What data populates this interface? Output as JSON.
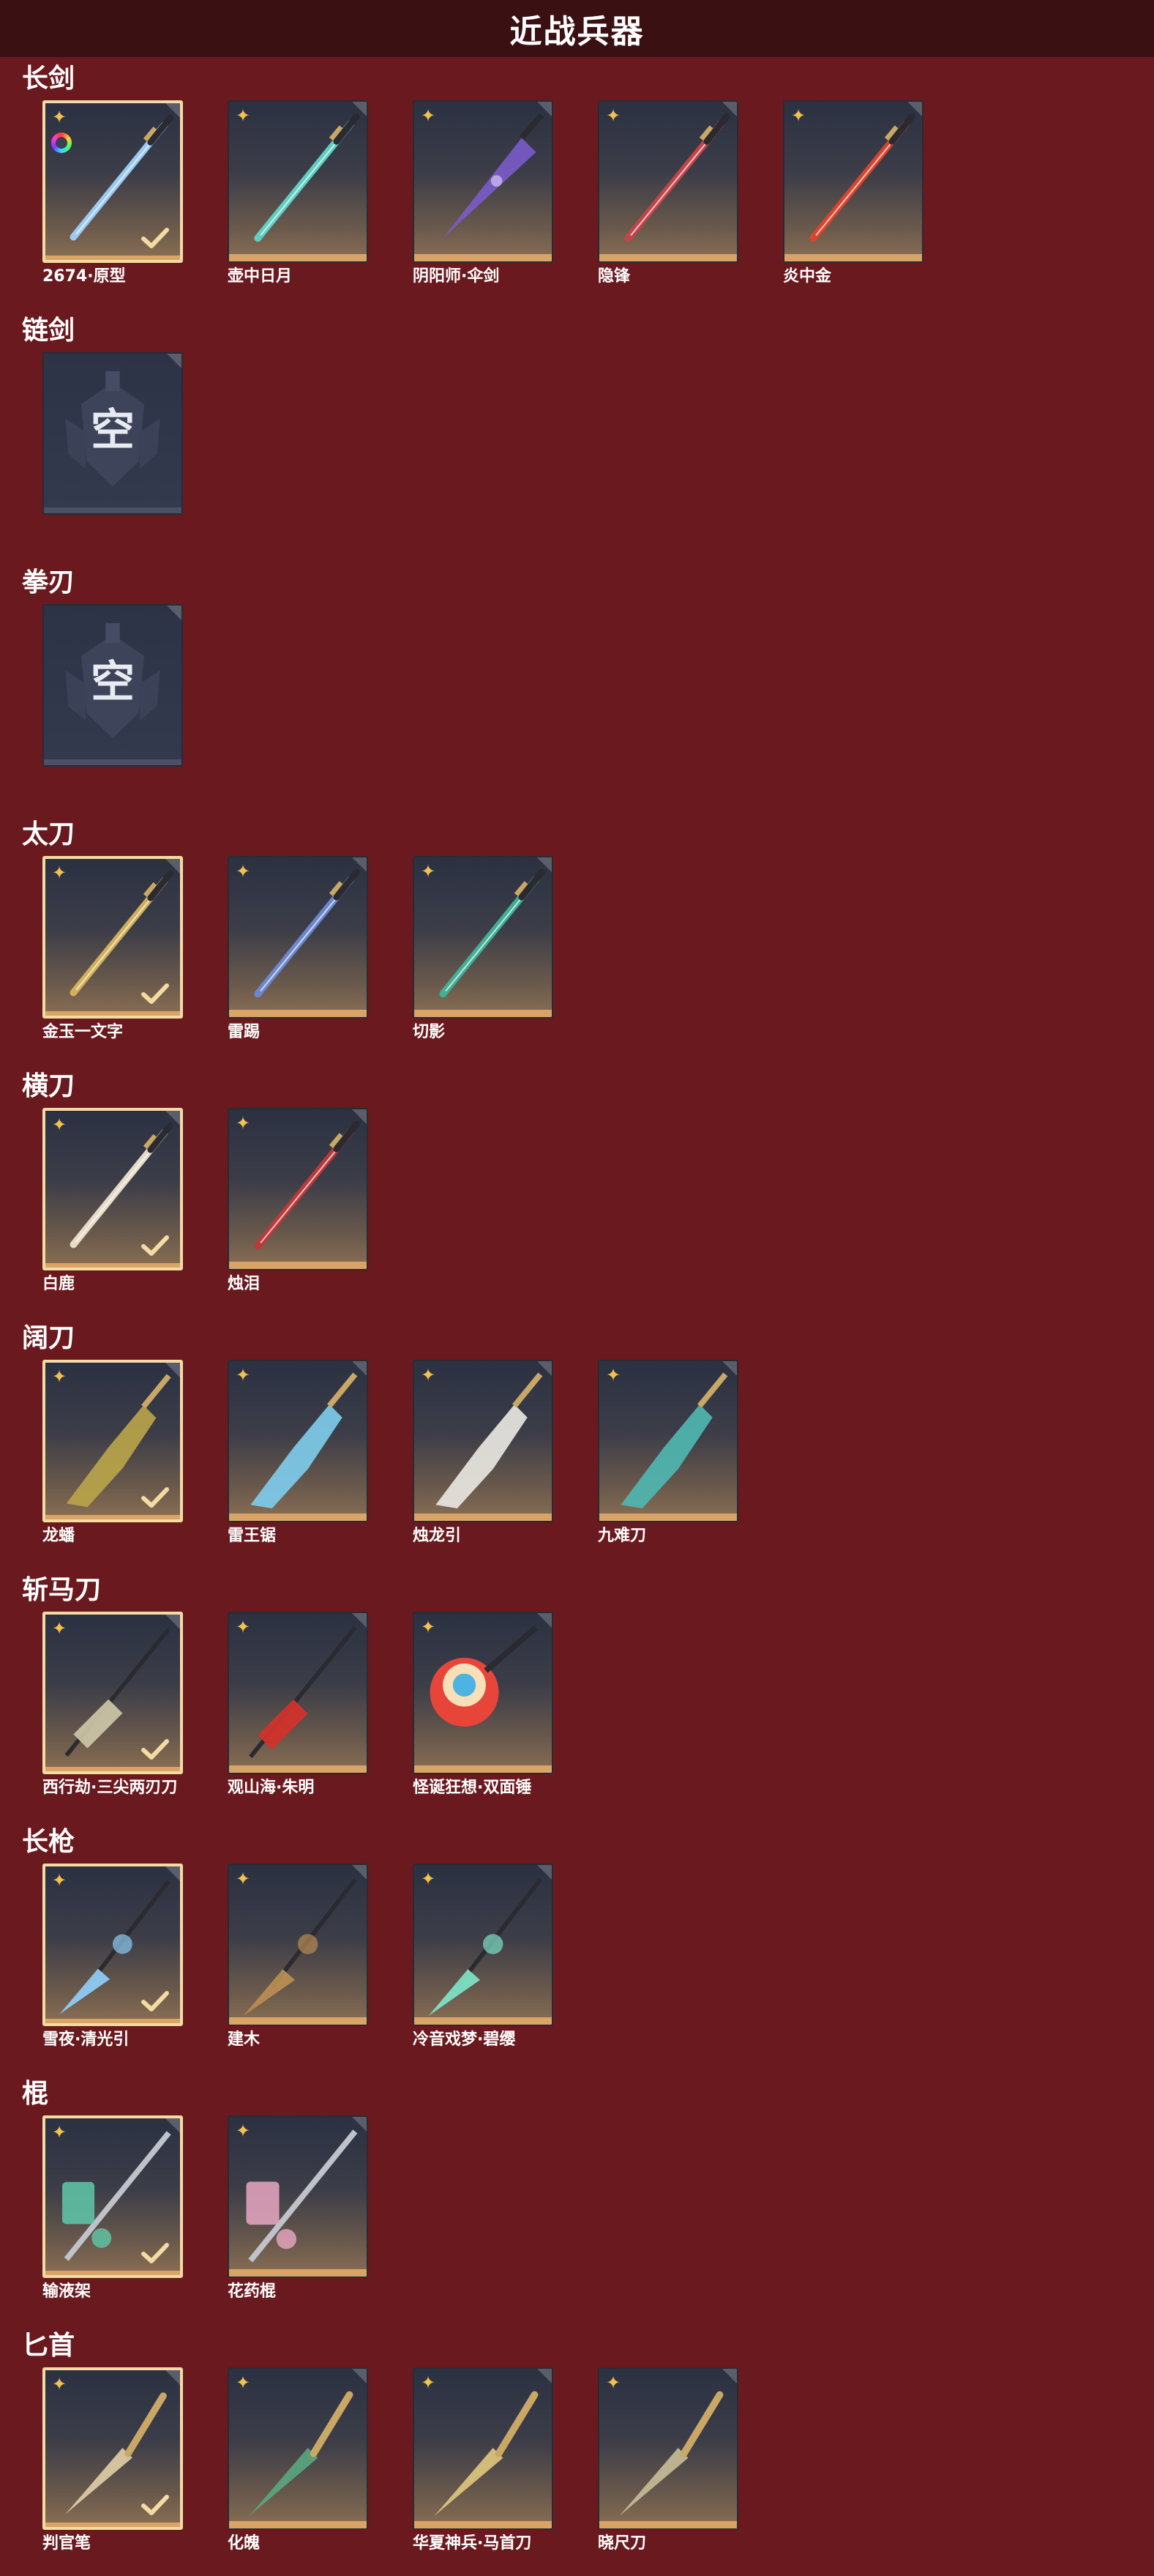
{
  "page": {
    "title": "近战兵器"
  },
  "colors": {
    "background": "#6a1a1f",
    "title_bar": "#3a1013",
    "equipped_border": "#f3dba3",
    "star": "#f2c14e",
    "tile_bottom": "#d9a466"
  },
  "icons": {
    "tile_star": "star-icon",
    "equipped_mark": "check-icon",
    "corner_tag": "corner-tag-icon",
    "color_wheel": "spectrum-icon"
  },
  "sections": [
    {
      "label": "长剑",
      "items": [
        {
          "name": "2674·原型",
          "equipped": true,
          "spectrum": true,
          "theme": "#9fd0ff",
          "art": "blade-glow"
        },
        {
          "name": "壶中日月",
          "equipped": false,
          "theme": "#5fd6c8",
          "art": "blade-jade"
        },
        {
          "name": "阴阳师·伞剑",
          "equipped": false,
          "theme": "#7b5bc9",
          "art": "umbrella"
        },
        {
          "name": "隐锋",
          "equipped": false,
          "theme": "#c8444a",
          "art": "blade-thin"
        },
        {
          "name": "炎中金",
          "equipped": false,
          "theme": "#e0442c",
          "art": "blade-fire"
        }
      ]
    },
    {
      "label": "链剑",
      "empty_text": "空",
      "items": []
    },
    {
      "label": "拳刃",
      "empty_text": "空",
      "items": []
    },
    {
      "label": "太刀",
      "items": [
        {
          "name": "金玉一文字",
          "equipped": true,
          "theme": "#d9b55a",
          "art": "katana-gold"
        },
        {
          "name": "雷踢",
          "equipped": false,
          "theme": "#6d8ad6",
          "art": "katana-blue"
        },
        {
          "name": "切影",
          "equipped": false,
          "theme": "#3fb59a",
          "art": "katana-dark"
        }
      ]
    },
    {
      "label": "横刀",
      "items": [
        {
          "name": "白鹿",
          "equipped": true,
          "theme": "#ede3cf",
          "art": "sabre-white"
        },
        {
          "name": "烛泪",
          "equipped": false,
          "theme": "#c2383a",
          "art": "sabre-red"
        }
      ]
    },
    {
      "label": "阔刀",
      "items": [
        {
          "name": "龙蟠",
          "equipped": true,
          "theme": "#b8a44a",
          "art": "broad-dragon"
        },
        {
          "name": "雷王锯",
          "equipped": false,
          "theme": "#7ecbea",
          "art": "broad-ice"
        },
        {
          "name": "烛龙引",
          "equipped": false,
          "theme": "#e8e6df",
          "art": "broad-white"
        },
        {
          "name": "九难刀",
          "equipped": false,
          "theme": "#4fb6b0",
          "art": "broad-teal"
        }
      ]
    },
    {
      "label": "斩马刀",
      "items": [
        {
          "name": "西行劫·三尖两刃刀",
          "equipped": true,
          "theme": "#c9c3a4",
          "art": "halberd"
        },
        {
          "name": "观山海·朱明",
          "equipped": false,
          "theme": "#d0332b",
          "art": "halberd-red"
        },
        {
          "name": "怪诞狂想·双面锤",
          "equipped": false,
          "theme": "#e34b2c",
          "art": "hammer-toy"
        }
      ]
    },
    {
      "label": "长枪",
      "items": [
        {
          "name": "雪夜·清光引",
          "equipped": true,
          "theme": "#8fcaf2",
          "art": "spear-ice"
        },
        {
          "name": "建木",
          "equipped": false,
          "theme": "#b88c52",
          "art": "spear-wood"
        },
        {
          "name": "冷音戏梦·碧缨",
          "equipped": false,
          "theme": "#7de0c6",
          "art": "spear-jade"
        }
      ]
    },
    {
      "label": "棍",
      "items": [
        {
          "name": "输液架",
          "equipped": true,
          "theme": "#5fc9a9",
          "art": "staff-drip"
        },
        {
          "name": "花药棍",
          "equipped": false,
          "theme": "#e8a7c2",
          "art": "staff-flower"
        }
      ]
    },
    {
      "label": "匕首",
      "items": [
        {
          "name": "判官笔",
          "equipped": true,
          "theme": "#d9c9a2",
          "art": "dagger-brush"
        },
        {
          "name": "化魄",
          "equipped": false,
          "theme": "#5aa27c",
          "art": "dagger-curve"
        },
        {
          "name": "华夏神兵·马首刀",
          "equipped": false,
          "theme": "#d8c27b",
          "art": "dagger-horse"
        },
        {
          "name": "晓尺刀",
          "equipped": false,
          "theme": "#c2b893",
          "art": "dagger-short"
        }
      ]
    }
  ]
}
